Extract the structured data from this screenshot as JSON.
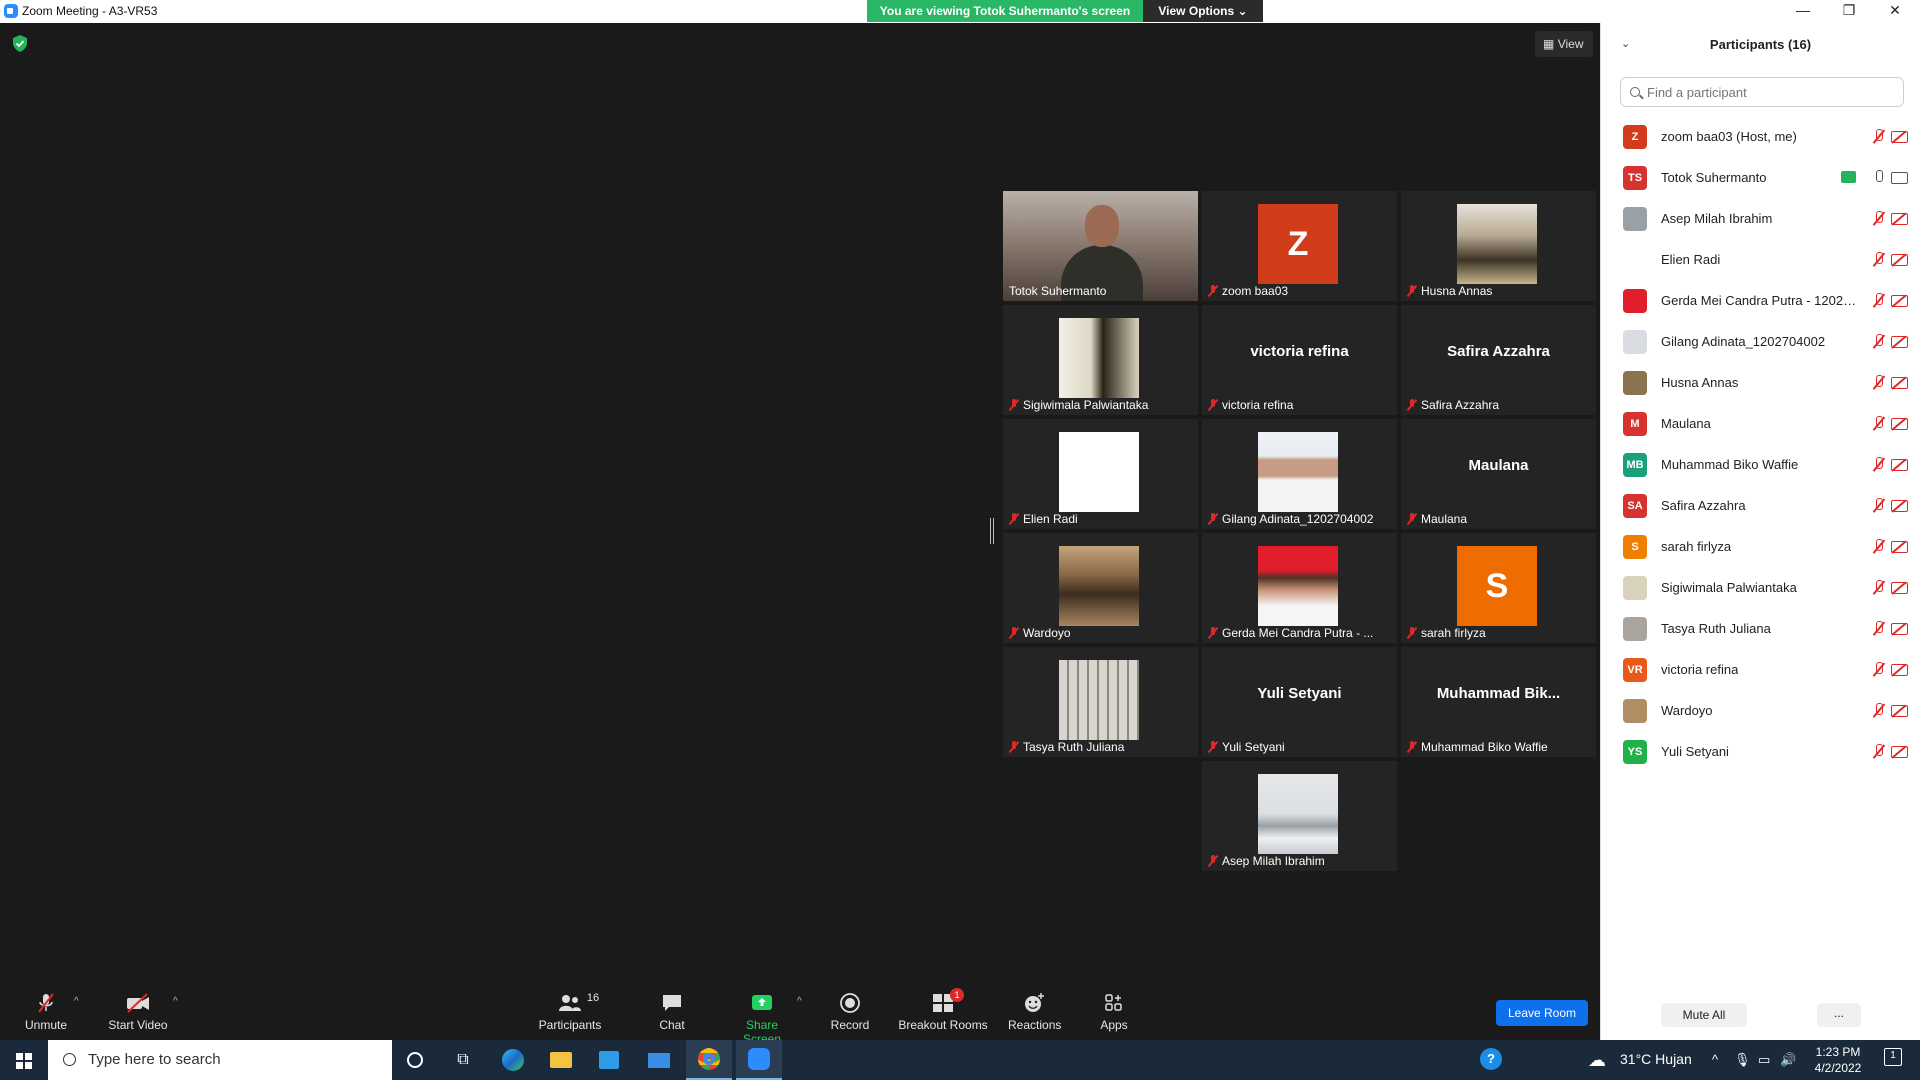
{
  "window": {
    "title": "Zoom Meeting - A3-VR53",
    "banner": "You are viewing Totok Suhermanto's screen",
    "view_options": "View Options",
    "minimize": "—",
    "restore": "❐",
    "close": "✕"
  },
  "main": {
    "view_label": "View",
    "tiles": [
      {
        "name": "Totok Suhermanto",
        "kind": "photo",
        "photo": "totok",
        "active": true,
        "muted": false
      },
      {
        "name": "zoom baa03",
        "kind": "initial",
        "initial": "Z",
        "color": "#d13d1b",
        "muted": true
      },
      {
        "name": "Husna Annas",
        "kind": "photo",
        "photo": "husna",
        "muted": true
      },
      {
        "name": "Sigiwimala Palwiantaka",
        "kind": "photo",
        "photo": "sigi",
        "muted": true
      },
      {
        "name": "victoria refina",
        "kind": "text",
        "bigname": "victoria refina",
        "muted": true
      },
      {
        "name": "Safira Azzahra",
        "kind": "text",
        "bigname": "Safira Azzahra",
        "muted": true
      },
      {
        "name": "Elien Radi",
        "kind": "photo",
        "photo": "elien",
        "muted": true
      },
      {
        "name": "Gilang Adinata_1202704002",
        "kind": "photo",
        "photo": "gilang",
        "muted": true
      },
      {
        "name": "Maulana",
        "kind": "text",
        "bigname": "Maulana",
        "muted": true
      },
      {
        "name": "Wardoyo",
        "kind": "photo",
        "photo": "wardoyo",
        "muted": true
      },
      {
        "name": "Gerda Mei Candra Putra - ...",
        "kind": "photo",
        "photo": "gerda",
        "muted": true
      },
      {
        "name": "sarah firlyza",
        "kind": "initial",
        "initial": "S",
        "color": "#ef6c00",
        "muted": true
      },
      {
        "name": "Tasya Ruth Juliana",
        "kind": "photo",
        "photo": "tasya",
        "muted": true
      },
      {
        "name": "Yuli Setyani",
        "kind": "text",
        "bigname": "Yuli Setyani",
        "muted": true
      },
      {
        "name": "Muhammad Biko Waffie",
        "kind": "text",
        "bigname": "Muhammad  Bik...",
        "muted": true
      },
      {
        "name": "Asep Milah Ibrahim",
        "kind": "photo",
        "photo": "asep",
        "muted": true
      }
    ]
  },
  "toolbar": {
    "unmute": "Unmute",
    "start_video": "Start Video",
    "participants": "Participants",
    "participants_count": "16",
    "chat": "Chat",
    "share_screen": "Share Screen",
    "record": "Record",
    "breakout_rooms": "Breakout Rooms",
    "breakout_badge": "1",
    "reactions": "Reactions",
    "apps": "Apps",
    "leave_room": "Leave Room",
    "caret": "^"
  },
  "panel": {
    "collapse": "⌄",
    "title": "Participants (16)",
    "search_placeholder": "Find a participant",
    "participants": [
      {
        "name": "zoom baa03 (Host, me)",
        "initials": "Z",
        "color": "#d13d1b",
        "mic": "muted",
        "cam": "off"
      },
      {
        "name": "Totok Suhermanto",
        "initials": "TS",
        "color": "#d6322f",
        "mic": "on",
        "cam": "on",
        "sharing": true
      },
      {
        "name": "Asep Milah Ibrahim",
        "initials": "",
        "color": "#9aa1a6",
        "mic": "muted",
        "cam": "off"
      },
      {
        "name": "Elien Radi",
        "initials": "",
        "color": "#ffffff",
        "mic": "muted",
        "cam": "off"
      },
      {
        "name": "Gerda Mei Candra Putra - 12027...",
        "initials": "",
        "color": "#e21e2d",
        "mic": "muted",
        "cam": "off"
      },
      {
        "name": "Gilang Adinata_1202704002",
        "initials": "",
        "color": "#d9dde2",
        "mic": "muted",
        "cam": "off"
      },
      {
        "name": "Husna Annas",
        "initials": "",
        "color": "#8b7350",
        "mic": "muted",
        "cam": "off"
      },
      {
        "name": "Maulana",
        "initials": "M",
        "color": "#d6322f",
        "mic": "muted",
        "cam": "off"
      },
      {
        "name": "Muhammad Biko Waffie",
        "initials": "MB",
        "color": "#1aa07a",
        "mic": "muted",
        "cam": "off"
      },
      {
        "name": "Safira Azzahra",
        "initials": "SA",
        "color": "#d6322f",
        "mic": "muted",
        "cam": "off"
      },
      {
        "name": "sarah firlyza",
        "initials": "S",
        "color": "#ef7f00",
        "mic": "muted",
        "cam": "off"
      },
      {
        "name": "Sigiwimala Palwiantaka",
        "initials": "",
        "color": "#d9d2bd",
        "mic": "muted",
        "cam": "off"
      },
      {
        "name": "Tasya Ruth Juliana",
        "initials": "",
        "color": "#a9a59e",
        "mic": "muted",
        "cam": "off"
      },
      {
        "name": "victoria refina",
        "initials": "VR",
        "color": "#e8591a",
        "mic": "muted",
        "cam": "off"
      },
      {
        "name": "Wardoyo",
        "initials": "",
        "color": "#b08d63",
        "mic": "muted",
        "cam": "off"
      },
      {
        "name": "Yuli Setyani",
        "initials": "YS",
        "color": "#21b14b",
        "mic": "muted",
        "cam": "off"
      }
    ],
    "mute_all": "Mute All",
    "more": "..."
  },
  "taskbar": {
    "search_placeholder": "Type here to search",
    "weather": "31°C  Hujan",
    "time": "1:23 PM",
    "date": "4/2/2022",
    "notification_count": "1"
  },
  "colors": {
    "accent_blue": "#0e71eb",
    "share_green": "#23d160",
    "active_speaker": "#c8e63c",
    "muted_red": "#e02828"
  }
}
